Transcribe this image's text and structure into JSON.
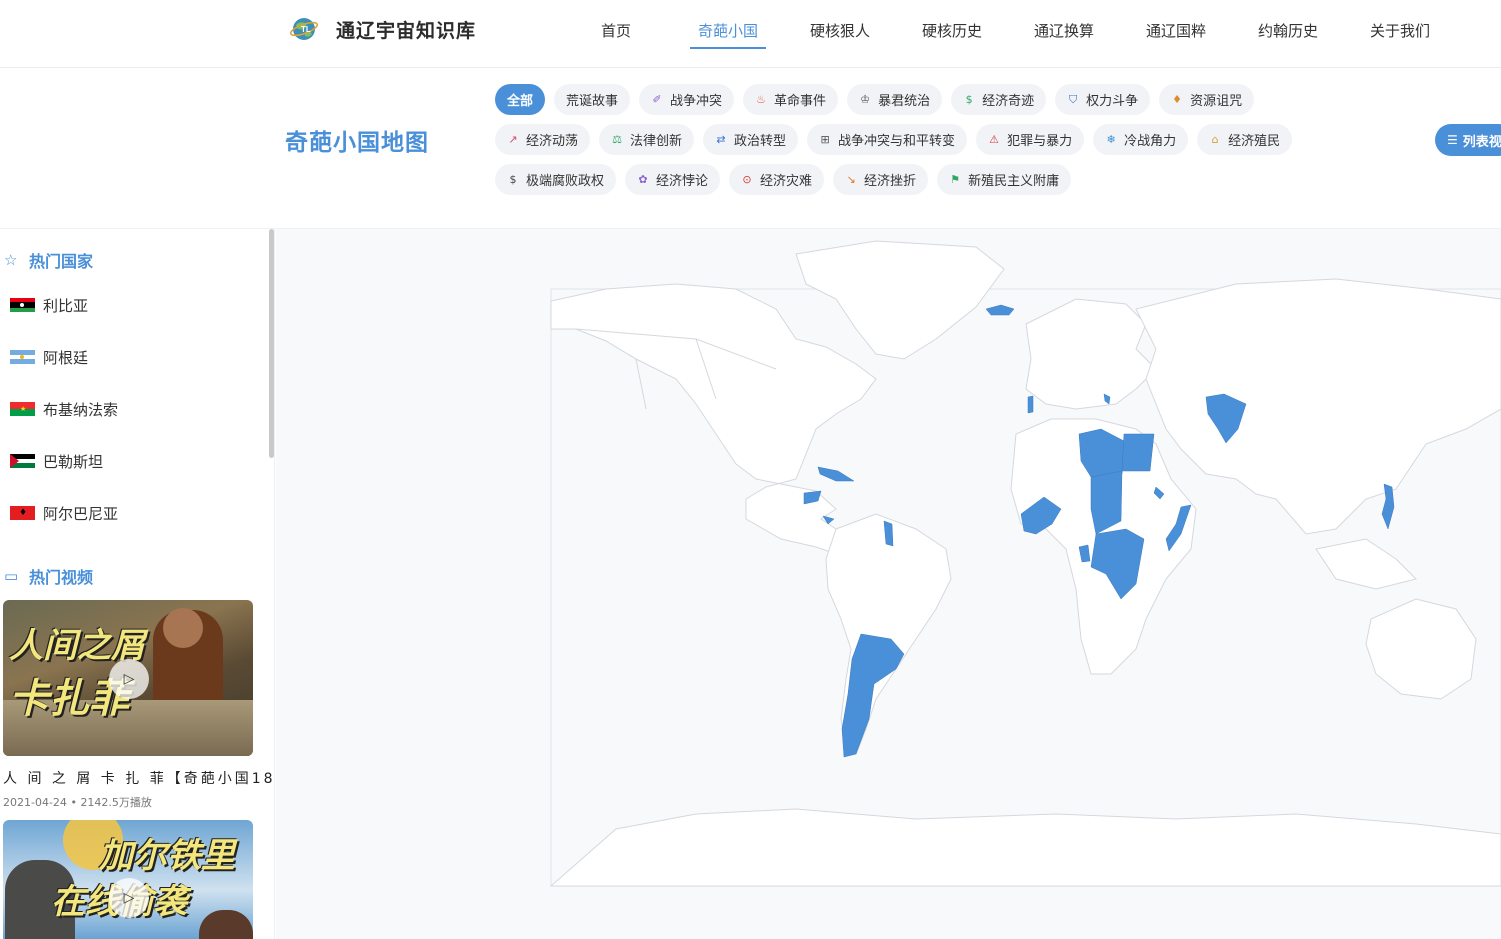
{
  "site": {
    "title": "通辽宇宙知识库",
    "logo_icon": "globe-logo-icon"
  },
  "nav": {
    "items": [
      {
        "label": "首页",
        "active": false
      },
      {
        "label": "奇葩小国",
        "active": true
      },
      {
        "label": "硬核狠人",
        "active": false
      },
      {
        "label": "硬核历史",
        "active": false
      },
      {
        "label": "通辽换算",
        "active": false
      },
      {
        "label": "通辽国粹",
        "active": false
      },
      {
        "label": "约翰历史",
        "active": false
      },
      {
        "label": "关于我们",
        "active": false
      }
    ]
  },
  "page": {
    "title": "奇葩小国地图",
    "list_view_label": "列表视"
  },
  "filters": {
    "rows": [
      [
        {
          "label": "全部",
          "icon": "",
          "icon_name": "",
          "active": true
        },
        {
          "label": "荒诞故事",
          "icon": "",
          "icon_name": "",
          "active": false
        },
        {
          "label": "战争冲突",
          "icon": "✐",
          "icon_name": "pen-icon",
          "color": "#8a63d2",
          "active": false
        },
        {
          "label": "革命事件",
          "icon": "♨",
          "icon_name": "flame-icon",
          "color": "#e05a3c",
          "active": false
        },
        {
          "label": "暴君统治",
          "icon": "♔",
          "icon_name": "crown-icon",
          "color": "#555555",
          "active": false
        },
        {
          "label": "经济奇迹",
          "icon": "$",
          "icon_name": "coin-icon",
          "color": "#2fa866",
          "active": false
        },
        {
          "label": "权力斗争",
          "icon": "⛉",
          "icon_name": "shield-icon",
          "color": "#3b6fd6",
          "active": false
        },
        {
          "label": "资源诅咒",
          "icon": "♦",
          "icon_name": "drop-icon",
          "color": "#e08a2c",
          "active": false
        }
      ],
      [
        {
          "label": "经济动荡",
          "icon": "↗",
          "icon_name": "trend-icon",
          "color": "#d64b6b",
          "active": false
        },
        {
          "label": "法律创新",
          "icon": "⚖",
          "icon_name": "scale-icon",
          "color": "#2fa866",
          "active": false
        },
        {
          "label": "政治转型",
          "icon": "⇄",
          "icon_name": "shuffle-icon",
          "color": "#3b6fd6",
          "active": false
        },
        {
          "label": "战争冲突与和平转变",
          "icon": "⊞",
          "icon_name": "grid-icon",
          "color": "#555555",
          "active": false
        },
        {
          "label": "犯罪与暴力",
          "icon": "⚠",
          "icon_name": "warning-icon",
          "color": "#d63b3b",
          "active": false
        },
        {
          "label": "冷战角力",
          "icon": "❄",
          "icon_name": "snowflake-icon",
          "color": "#3b8fd6",
          "active": false
        },
        {
          "label": "经济殖民",
          "icon": "⌂",
          "icon_name": "bank-icon",
          "color": "#d6a23b",
          "active": false
        }
      ],
      [
        {
          "label": "极端腐败政权",
          "icon": "$",
          "icon_name": "dollar-icon",
          "color": "#444444",
          "active": false
        },
        {
          "label": "经济悖论",
          "icon": "✿",
          "icon_name": "puzzle-icon",
          "color": "#8a63d2",
          "active": false
        },
        {
          "label": "经济灾难",
          "icon": "⊙",
          "icon_name": "alert-circle-icon",
          "color": "#d63b3b",
          "active": false
        },
        {
          "label": "经济挫折",
          "icon": "↘",
          "icon_name": "trend-down-icon",
          "color": "#e07a2c",
          "active": false
        },
        {
          "label": "新殖民主义附庸",
          "icon": "⚑",
          "icon_name": "flag-icon",
          "color": "#2fa866",
          "active": false
        }
      ]
    ]
  },
  "sidebar": {
    "hot_countries_title": "热门国家",
    "hot_countries_icon": "star-icon",
    "countries": [
      {
        "name": "利比亚",
        "flag": "libya"
      },
      {
        "name": "阿根廷",
        "flag": "argentina"
      },
      {
        "name": "布基纳法索",
        "flag": "burkina"
      },
      {
        "name": "巴勒斯坦",
        "flag": "palestine"
      },
      {
        "name": "阿尔巴尼亚",
        "flag": "albania"
      }
    ],
    "hot_videos_title": "热门视频",
    "hot_videos_icon": "video-icon",
    "videos": [
      {
        "thumb_line1": "人间之屑",
        "thumb_line2": "卡扎菲",
        "title": "人 间 之 屑 卡 扎 菲【奇葩小国18】",
        "date": "2021-04-24",
        "plays": "2142.5万播放"
      },
      {
        "thumb_line1": "加尔铁里",
        "thumb_line2": "在线偷袭",
        "title": "",
        "date": "",
        "plays": ""
      }
    ]
  },
  "map": {
    "highlight_color": "#4a90d9",
    "land_color": "#ffffff",
    "border_color": "#d4d8de",
    "highlighted_regions": [
      "冰岛",
      "葡萄牙",
      "意大利南部",
      "利比亚",
      "埃及",
      "苏丹",
      "乍得",
      "中非",
      "刚果",
      "刚果(金)",
      "卢旺达",
      "布基纳法索",
      "科特迪瓦",
      "加纳",
      "加蓬",
      "厄立特里亚",
      "索马里",
      "阿富汗",
      "伊朗东部",
      "菲律宾",
      "古巴",
      "海地",
      "洪都拉斯",
      "巴拿马",
      "圭亚那",
      "阿根廷",
      "智利"
    ]
  }
}
